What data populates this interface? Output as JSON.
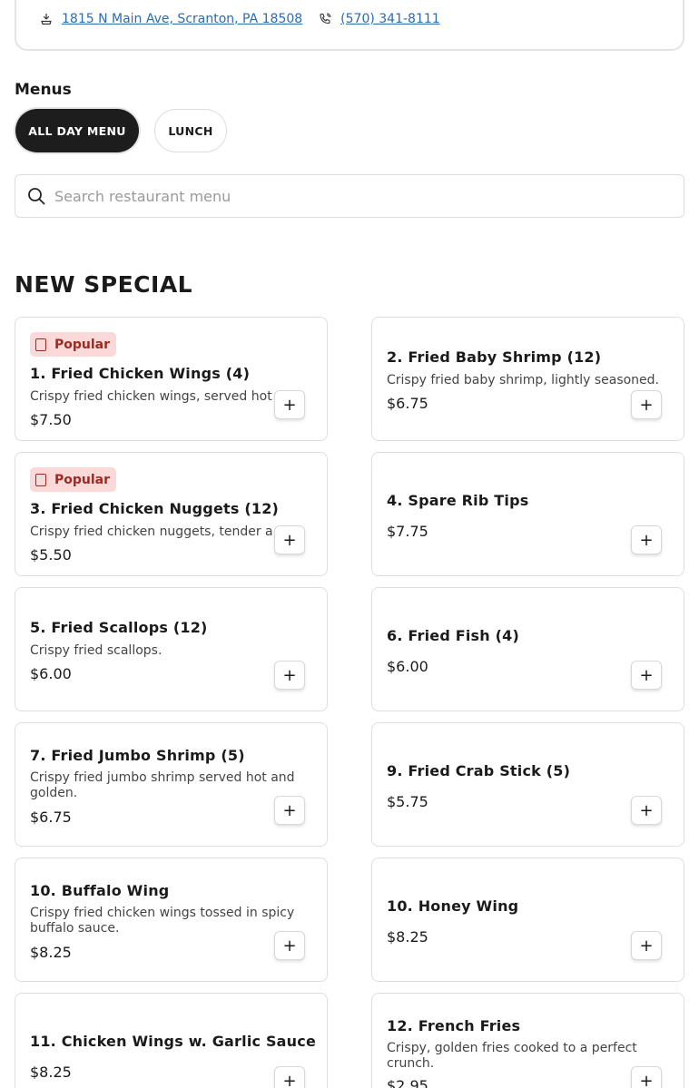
{
  "restaurant": {
    "address": "1815 N Main Ave, Scranton, PA 18508",
    "phone": "(570) 341-8111"
  },
  "menus": {
    "label": "Menus",
    "tabs": [
      "ALL DAY MENU",
      "LUNCH"
    ],
    "active_tab": "ALL DAY MENU"
  },
  "search": {
    "placeholder": "Search restaurant menu"
  },
  "section": {
    "title": "NEW SPECIAL",
    "popular_label": "Popular",
    "add_label": "+",
    "items": [
      {
        "name": "1. Fried Chicken Wings (4)",
        "description": "Crispy fried chicken wings, served hot",
        "price": "$7.50",
        "popular": true
      },
      {
        "name": "2. Fried Baby Shrimp (12)",
        "description": "Crispy fried baby shrimp, lightly seasoned.",
        "price": "$6.75",
        "popular": false
      },
      {
        "name": "3. Fried Chicken Nuggets (12)",
        "description": "Crispy fried chicken nuggets, tender a",
        "price": "$5.50",
        "popular": true
      },
      {
        "name": "4. Spare Rib Tips",
        "description": "",
        "price": "$7.75",
        "popular": false
      },
      {
        "name": "5. Fried Scallops (12)",
        "description": "Crispy fried scallops.",
        "price": "$6.00",
        "popular": false
      },
      {
        "name": "6. Fried Fish (4)",
        "description": "",
        "price": "$6.00",
        "popular": false
      },
      {
        "name": "7. Fried Jumbo Shrimp (5)",
        "description": "Crispy fried jumbo shrimp served hot and golden.",
        "price": "$6.75",
        "popular": false
      },
      {
        "name": "9. Fried Crab Stick (5)",
        "description": "",
        "price": "$5.75",
        "popular": false
      },
      {
        "name": "10. Buffalo Wing",
        "description": "Crispy fried chicken wings tossed in spicy buffalo sauce.",
        "price": "$8.25",
        "popular": false
      },
      {
        "name": "10. Honey Wing",
        "description": "",
        "price": "$8.25",
        "popular": false
      },
      {
        "name": "11. Chicken Wings w. Garlic Sauce",
        "description": "",
        "price": "$8.25",
        "popular": false
      },
      {
        "name": "12. French Fries",
        "description": "Crispy, golden fries cooked to a perfect crunch.",
        "price": "$2.95",
        "popular": false
      }
    ]
  },
  "colors": {
    "link": "#2a6cb0",
    "active_tab_bg": "#1d1d1d",
    "popular_badge_bg": "#fcd9d9",
    "popular_badge_text": "#9e2a22"
  },
  "icons": {
    "address": "location-hand-icon",
    "phone": "phone-icon",
    "search": "search-icon",
    "popular": "popular-icon"
  }
}
